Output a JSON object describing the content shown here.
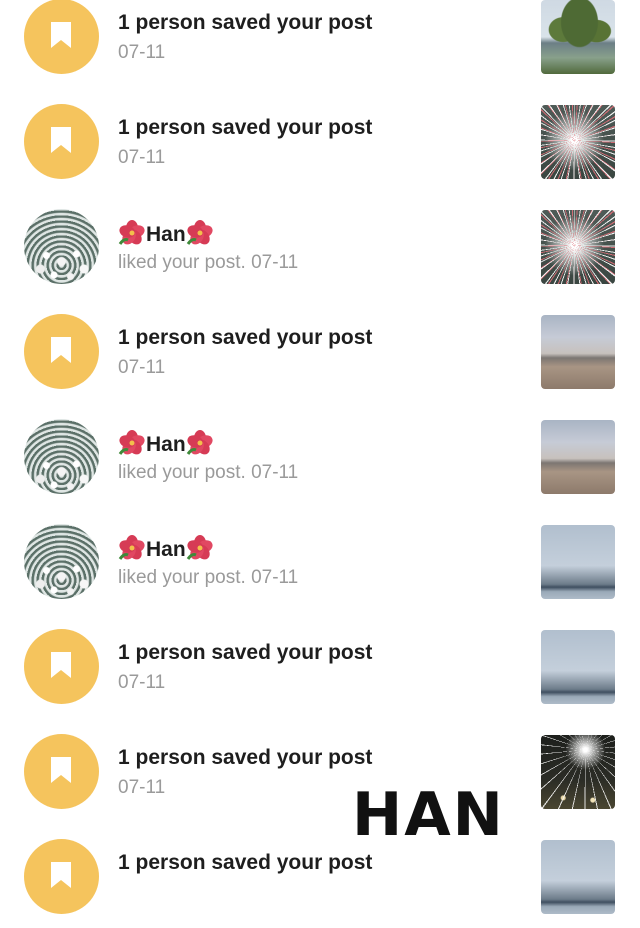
{
  "notifications": [
    {
      "type": "saved",
      "title": "1 person saved your post",
      "subtitle": "07-11",
      "thumbnail": "trees-lake"
    },
    {
      "type": "saved",
      "title": "1 person saved your post",
      "subtitle": "07-11",
      "thumbnail": "fireworks"
    },
    {
      "type": "like",
      "user_name": "Han",
      "user_emoji": "hibiscus",
      "subtitle": "liked your post. 07-11",
      "thumbnail": "fireworks"
    },
    {
      "type": "saved",
      "title": "1 person saved your post",
      "subtitle": "07-11",
      "thumbnail": "beach"
    },
    {
      "type": "like",
      "user_name": "Han",
      "user_emoji": "hibiscus",
      "subtitle": "liked your post. 07-11",
      "thumbnail": "beach"
    },
    {
      "type": "like",
      "user_name": "Han",
      "user_emoji": "hibiscus",
      "subtitle": "liked your post. 07-11",
      "thumbnail": "sea"
    },
    {
      "type": "saved",
      "title": "1 person saved your post",
      "subtitle": "07-11",
      "thumbnail": "sea"
    },
    {
      "type": "saved",
      "title": "1 person saved your post",
      "subtitle": "07-11",
      "thumbnail": "night-fireworks"
    },
    {
      "type": "saved",
      "title": "1 person saved your post",
      "subtitle": "",
      "thumbnail": "sea"
    }
  ],
  "watermark": "HAN",
  "colors": {
    "saved_badge": "#f5c45d",
    "title_text": "#1e1e1e",
    "subtitle_text": "#9a9a9a",
    "background": "#ffffff"
  },
  "icons": {
    "saved_badge": "bookmark-icon",
    "user_emoji": "hibiscus-icon"
  }
}
